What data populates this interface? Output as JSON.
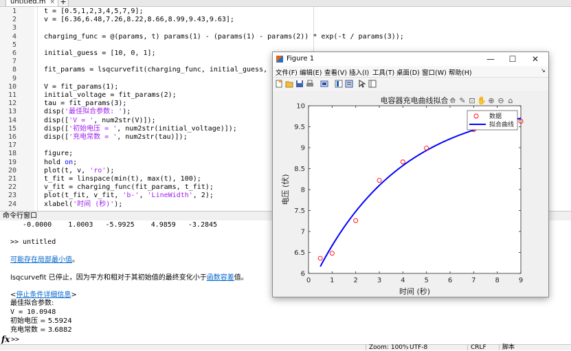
{
  "editor": {
    "tab_label": "untitled.m",
    "tab_close": "×",
    "tab_add": "+",
    "lines": [
      {
        "n": "1",
        "parts": [
          {
            "t": "t = [0.5,1,2,3,4,5,7,9];"
          }
        ]
      },
      {
        "n": "2",
        "parts": [
          {
            "t": "v = [6.36,6.48,7.26,8.22,8.66,8.99,9.43,9.63];"
          }
        ]
      },
      {
        "n": "3",
        "parts": []
      },
      {
        "n": "4",
        "parts": [
          {
            "t": "charging_func = @(params, t) params(1) - (params(1) - params(2)) * exp(-t / params(3));"
          }
        ]
      },
      {
        "n": "5",
        "parts": []
      },
      {
        "n": "6",
        "parts": [
          {
            "t": "initial_guess = [10, 0, 1];"
          }
        ]
      },
      {
        "n": "7",
        "parts": []
      },
      {
        "n": "8",
        "parts": [
          {
            "t": "fit_params = lsqcurvefit(charging_func, initial_guess, t, v);"
          }
        ]
      },
      {
        "n": "9",
        "parts": []
      },
      {
        "n": "10",
        "parts": [
          {
            "t": "V = fit_params(1);"
          }
        ]
      },
      {
        "n": "11",
        "parts": [
          {
            "t": "initial_voltage = fit_params(2);"
          }
        ]
      },
      {
        "n": "12",
        "parts": [
          {
            "t": "tau = fit_params(3);"
          }
        ]
      },
      {
        "n": "13",
        "parts": [
          {
            "t": "disp("
          },
          {
            "t": "'最佳拟合参数: '",
            "c": "str"
          },
          {
            "t": ");"
          }
        ]
      },
      {
        "n": "14",
        "parts": [
          {
            "t": "disp(["
          },
          {
            "t": "'V = '",
            "c": "str"
          },
          {
            "t": ", num2str(V)]);"
          }
        ]
      },
      {
        "n": "15",
        "parts": [
          {
            "t": "disp(["
          },
          {
            "t": "'初始电压 = '",
            "c": "str"
          },
          {
            "t": ", num2str(initial_voltage)]);"
          }
        ]
      },
      {
        "n": "16",
        "parts": [
          {
            "t": "disp(["
          },
          {
            "t": "'充电常数 = '",
            "c": "str"
          },
          {
            "t": ", num2str(tau)]);"
          }
        ]
      },
      {
        "n": "17",
        "parts": []
      },
      {
        "n": "18",
        "parts": [
          {
            "t": "figure;"
          }
        ]
      },
      {
        "n": "19",
        "parts": [
          {
            "t": "hold "
          },
          {
            "t": "on",
            "c": "kw"
          },
          {
            "t": ";"
          }
        ]
      },
      {
        "n": "20",
        "parts": [
          {
            "t": "plot(t, v, "
          },
          {
            "t": "'ro'",
            "c": "str"
          },
          {
            "t": ");"
          }
        ]
      },
      {
        "n": "21",
        "parts": [
          {
            "t": "t_fit = linspace(min(t), max(t), 100);"
          }
        ]
      },
      {
        "n": "22",
        "parts": [
          {
            "t": "v_fit = charging_func(fit_params, t_fit);"
          }
        ]
      },
      {
        "n": "23",
        "parts": [
          {
            "t": "plot(t_fit, v_fit, "
          },
          {
            "t": "'b-'",
            "c": "str"
          },
          {
            "t": ", "
          },
          {
            "t": "'LineWidth'",
            "c": "str"
          },
          {
            "t": ", 2);"
          }
        ]
      },
      {
        "n": "24",
        "parts": [
          {
            "t": "xlabel("
          },
          {
            "t": "'时间 (秒)'",
            "c": "str"
          },
          {
            "t": ");"
          }
        ]
      }
    ]
  },
  "command_window": {
    "title": "命令行窗口",
    "values_row": "   -0.0000    1.0003   -5.9925    4.9859   -3.2845",
    "run_cmd": ">> untitled",
    "local_min_link": "可能存在局部最小值",
    "local_min_suffix": "。",
    "stop_prefix": "lsqcurvefit 已停止，因为平方和相对于其初始值的最终变化小于",
    "stop_link": "函数容差",
    "stop_suffix": "值。",
    "criteria_open": "<",
    "criteria_link": "停止条件详细信息",
    "criteria_close": ">",
    "best_params": "最佳拟合参数:",
    "v_line": "V = 10.0948",
    "init_voltage_line": "初始电压 = 5.5924",
    "charge_const_line": "充电常数 = 3.6882",
    "fx": "fx",
    "prompt": ">>"
  },
  "status_bar": {
    "zoom": "Zoom: 100%",
    "encoding": "UTF-8",
    "eol": "CRLF",
    "type": "脚本"
  },
  "figure": {
    "window_title": "Figure 1",
    "minimize": "—",
    "maximize": "☐",
    "close": "✕",
    "menus": [
      "文件(F)",
      "编辑(E)",
      "查看(V)",
      "插入(I)",
      "工具(T)",
      "桌面(D)",
      "窗口(W)",
      "帮助(H)"
    ],
    "toolbar_icons": [
      "new-figure-icon",
      "open-file-icon",
      "save-icon",
      "print-icon",
      "link-plot-icon",
      "insert-colorbar-icon",
      "insert-legend-icon",
      "edit-plot-icon",
      "property-inspector-icon"
    ],
    "axes_toolbar_icons": [
      "export-icon",
      "brush-icon",
      "datatip-icon",
      "pan-icon",
      "zoom-in-icon",
      "zoom-out-icon",
      "home-icon"
    ]
  },
  "chart_data": {
    "type": "scatter",
    "title": "电容器充电曲线拟合",
    "xlabel": "时间 (秒)",
    "ylabel": "电压 (伏)",
    "xlim": [
      0,
      9
    ],
    "ylim": [
      6,
      10
    ],
    "xticks": [
      "0",
      "1",
      "2",
      "3",
      "4",
      "5",
      "6",
      "7",
      "8",
      "9"
    ],
    "yticks": [
      "6",
      "6.5",
      "7",
      "7.5",
      "8",
      "8.5",
      "9",
      "9.5",
      "10"
    ],
    "grid": false,
    "legend_position": "top-right",
    "series": [
      {
        "name": "数据",
        "type": "scatter",
        "marker": "circle",
        "color": "#ff0000",
        "x": [
          0.5,
          1,
          2,
          3,
          4,
          5,
          7,
          9
        ],
        "y": [
          6.36,
          6.48,
          7.26,
          8.22,
          8.66,
          8.99,
          9.43,
          9.63
        ]
      },
      {
        "name": "拟合曲线",
        "type": "line",
        "color": "#0000ff",
        "model": {
          "V": 10.0948,
          "initial_voltage": 5.5924,
          "tau": 3.6882
        }
      }
    ]
  }
}
